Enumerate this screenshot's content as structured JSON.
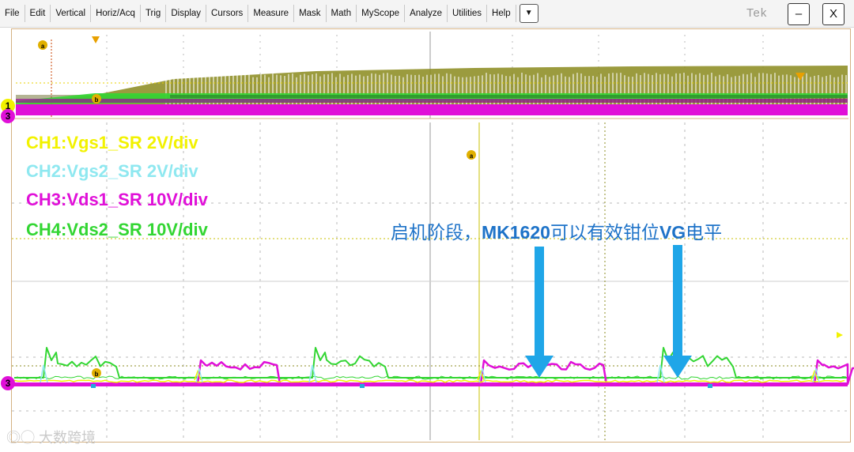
{
  "menu": {
    "items": [
      "File",
      "Edit",
      "Vertical",
      "Horiz/Acq",
      "Trig",
      "Display",
      "Cursors",
      "Measure",
      "Mask",
      "Math",
      "MyScope",
      "Analyze",
      "Utilities",
      "Help"
    ],
    "dropdown_glyph": "▼"
  },
  "brand": "Tek",
  "window": {
    "minimize": "–",
    "close": "X"
  },
  "legend": [
    {
      "label": "CH1:Vgs1_SR 2V/div",
      "color": "#f2f200"
    },
    {
      "label": "CH2:Vgs2_SR 2V/div",
      "color": "#8fe8f0"
    },
    {
      "label": "CH3:Vds1_SR 10V/div",
      "color": "#e010d8"
    },
    {
      "label": "CH4:Vds2_SR 10V/div",
      "color": "#33d633"
    }
  ],
  "annotation": {
    "prefix": "启机阶段，",
    "bold1": "MK1620",
    "middle": "可以有效钳位",
    "bold2": "VG",
    "suffix": "电平"
  },
  "markers": {
    "cursor_a": "a",
    "cursor_b": "b",
    "ch1_ref": "1",
    "ch3_ref": "3"
  },
  "watermark": "大数跨境",
  "colors": {
    "ch1": "#f2f200",
    "ch2": "#8fe8f0",
    "ch3": "#e010d8",
    "ch4": "#33d633",
    "olive": "#8a8a1c",
    "arrow": "#1fa6e8",
    "grid": "#b9b9b9",
    "cursor": "#c8c000",
    "annotation": "#1e73c8"
  }
}
